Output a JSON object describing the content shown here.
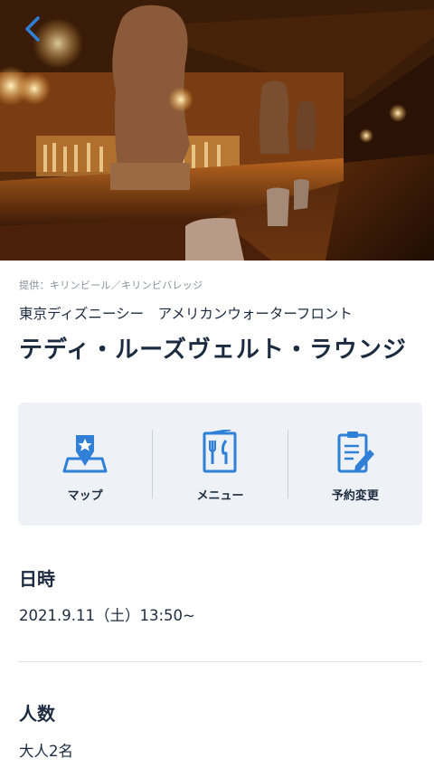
{
  "header": {
    "back_icon": "chevron-left-icon",
    "accent_color": "#2f80d6"
  },
  "credit": "提供：キリンビール／キリンビバレッジ",
  "area": "東京ディズニーシー　アメリカンウォーターフロント",
  "title": "テディ・ルーズヴェルト・ラウンジ",
  "actions": [
    {
      "icon": "map-pin-icon",
      "label": "マップ"
    },
    {
      "icon": "menu-icon",
      "label": "メニュー"
    },
    {
      "icon": "reservation-edit-icon",
      "label": "予約変更"
    }
  ],
  "datetime": {
    "heading": "日時",
    "value": "2021.9.11（土）13:50~"
  },
  "party": {
    "heading": "人数",
    "value": "大人2名"
  },
  "colors": {
    "text": "#1c2b40",
    "icon_blue": "#2f80d6",
    "panel_bg": "#eef2f6"
  }
}
